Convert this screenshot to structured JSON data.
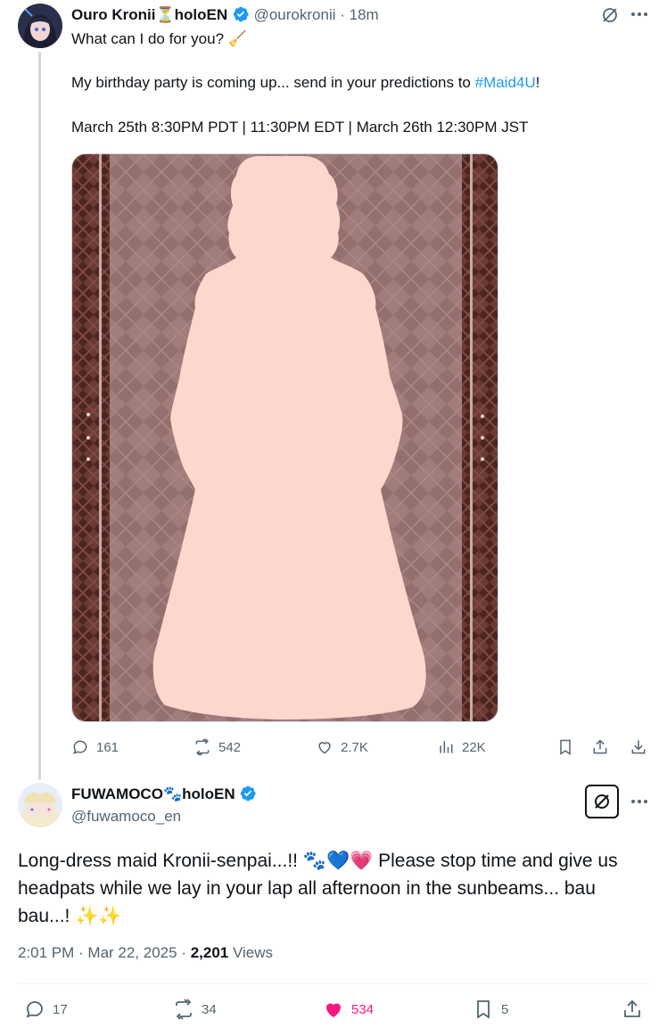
{
  "post1": {
    "display_name": "Ouro Kronii",
    "name_emoji": "⏳",
    "name_suffix": "holoEN",
    "handle": "@ourokronii",
    "separator": "·",
    "time": "18m",
    "line1": "What can I do for you?",
    "line1_emoji": "🧹",
    "line2_before": "My birthday party is coming up... send in your predictions to ",
    "hashtag": "#Maid4U",
    "line2_after": "!",
    "line3": "March 25th 8:30PM PDT | 11:30PM EDT | March 26th 12:30PM JST",
    "stats": {
      "replies": "161",
      "reposts": "542",
      "likes": "2.7K",
      "views": "22K"
    }
  },
  "post2": {
    "display_name": "FUWAMOCO",
    "name_emoji": "🐾",
    "name_suffix": "holoEN",
    "handle": "@fuwamoco_en",
    "text_main": "Long-dress maid Kronii-senpai...!! ",
    "text_emojis": "🐾💙💗",
    "text_rest": " Please stop time and give us headpats while we lay in your lap all afternoon in the sunbeams... bau bau...! ",
    "text_end_emojis": "✨✨",
    "timestamp": "2:01 PM · Mar 22, 2025 · ",
    "views_count": "2,201",
    "views_label": " Views",
    "stats": {
      "replies": "17",
      "reposts": "34",
      "likes": "534",
      "bookmarks": "5"
    }
  },
  "colors": {
    "accent": "#1d9bf0",
    "like_active": "#f91880",
    "muted": "#536471",
    "plaid_dark": "#5a2e28",
    "plaid_center": "#9e7b79",
    "silhouette": "#fdd6ce"
  }
}
